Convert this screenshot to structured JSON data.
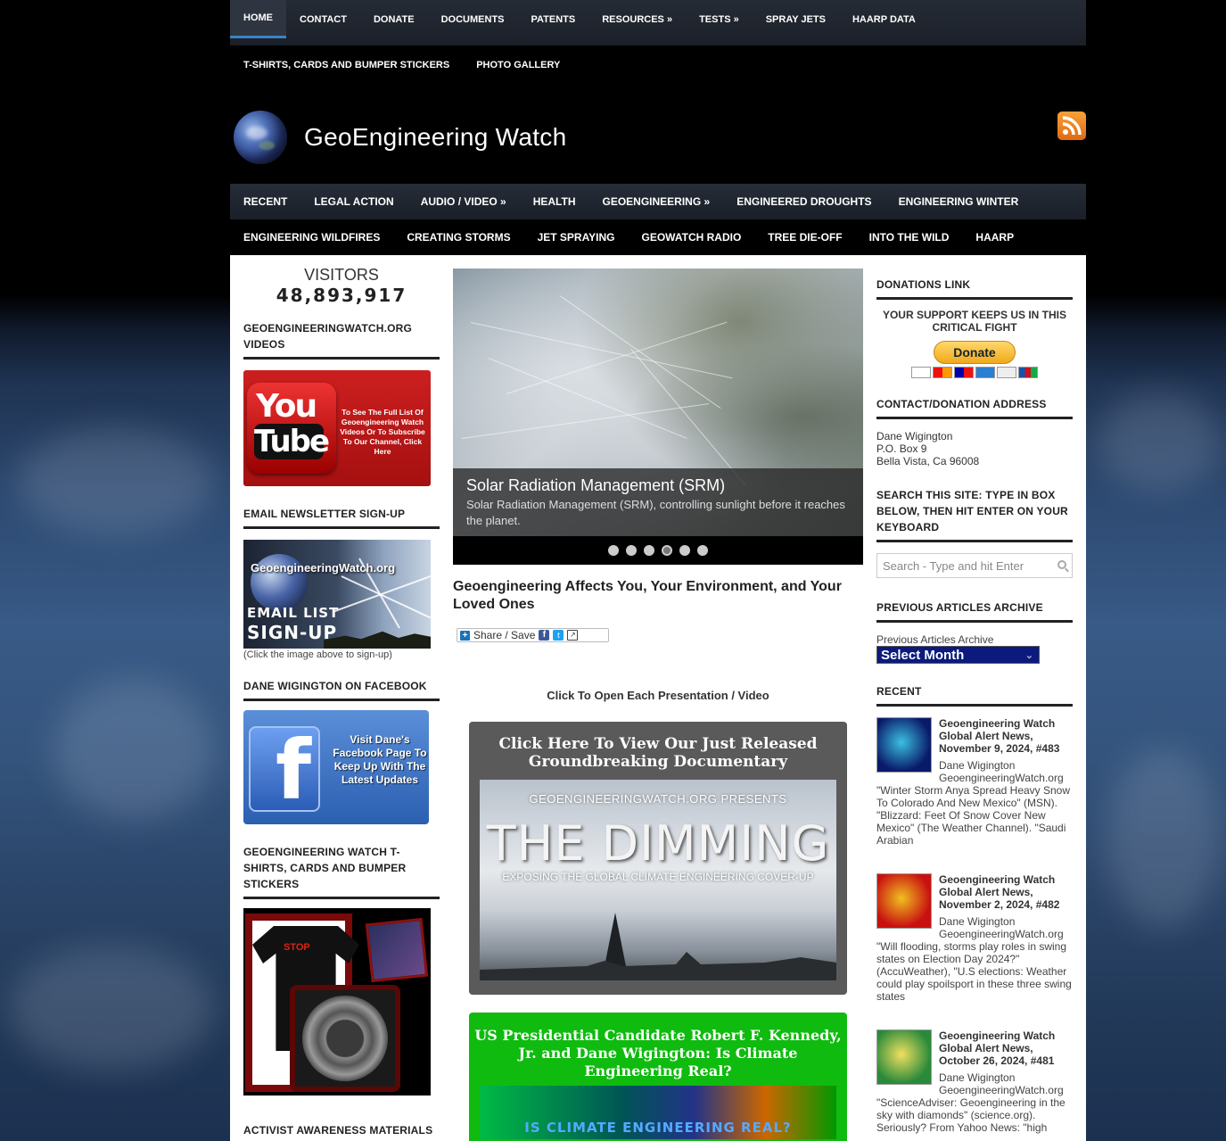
{
  "topnav": {
    "row1": [
      {
        "label": "HOME",
        "active": true
      },
      {
        "label": "CONTACT"
      },
      {
        "label": "DONATE"
      },
      {
        "label": "DOCUMENTS"
      },
      {
        "label": "PATENTS"
      },
      {
        "label": "RESOURCES »"
      },
      {
        "label": "TESTS »"
      },
      {
        "label": "SPRAY JETS"
      },
      {
        "label": "HAARP DATA"
      }
    ],
    "row2": [
      {
        "label": "T-SHIRTS, CARDS AND BUMPER STICKERS"
      },
      {
        "label": "PHOTO GALLERY"
      }
    ]
  },
  "header": {
    "title": "GeoEngineering Watch",
    "rss_icon": "rss-icon"
  },
  "mainnav": {
    "row1": [
      "RECENT",
      "LEGAL ACTION",
      "AUDIO / VIDEO  »",
      "HEALTH",
      "GEOENGINEERING  »",
      "ENGINEERED DROUGHTS",
      "ENGINEERING WINTER"
    ],
    "row2": [
      "ENGINEERING WILDFIRES",
      "CREATING STORMS",
      "JET SPRAYING",
      "GEOWATCH RADIO",
      "TREE DIE-OFF",
      "INTO THE WILD",
      "HAARP"
    ]
  },
  "left": {
    "visitors_label": "VISITORS",
    "visitors_count": "48,893,917",
    "videos_title": "GEOENGINEERINGWATCH.ORG VIDEOS",
    "youtube": {
      "you": "You",
      "tube": "Tube",
      "text": "To See The Full List Of Geoengineering Watch Videos Or To Subscribe To Our Channel, Click Here"
    },
    "newsletter_title": "EMAIL NEWSLETTER SIGN-UP",
    "newsletter": {
      "brand": "GeoengineeringWatch.org",
      "line1": "EMAIL LIST",
      "line2": "SIGN-UP",
      "caption": "(Click the image above to sign-up)"
    },
    "facebook_title": "DANE WIGINGTON ON FACEBOOK",
    "facebook_text": "Visit Dane's Facebook Page To Keep Up With The Latest Updates",
    "shirts_title": "GEOENGINEERING WATCH T-SHIRTS, CARDS AND BUMPER STICKERS",
    "shirts_stop": "STOP",
    "activist_title": "ACTIVIST AWARENESS MATERIALS"
  },
  "slider": {
    "title": "Solar Radiation Management (SRM)",
    "desc": "Solar Radiation Management (SRM), controlling sunlight before it reaches the planet.",
    "dots": 6,
    "active_dot": 4
  },
  "post": {
    "title": "Geoengineering Affects You, Your Environment, and Your Loved Ones",
    "share_label": "Share / Save",
    "click_open": "Click To Open Each Presentation / Video"
  },
  "promo1": {
    "head": "Click Here To View Our Just Released Groundbreaking Documentary",
    "presents": "GEOENGINEERINGWATCH.ORG PRESENTS",
    "big": "THE DIMMING",
    "sub": "EXPOSING THE GLOBAL CLIMATE ENGINEERING COVER-UP"
  },
  "promo2": {
    "head": "US Presidential Candidate Robert F. Kennedy, Jr. and Dane Wigington: Is Climate Engineering Real?",
    "strip": "IS CLIMATE ENGINEERING REAL?"
  },
  "right": {
    "donations_title": "DONATIONS LINK",
    "support": "YOUR SUPPORT KEEPS US IN THIS CRITICAL FIGHT",
    "donate_label": "Donate",
    "address_title": "CONTACT/DONATION ADDRESS",
    "address": [
      "Dane Wigington",
      "P.O. Box 9",
      "Bella Vista, Ca 96008"
    ],
    "search_title": "SEARCH THIS SITE: TYPE IN BOX BELOW, THEN HIT ENTER ON YOUR KEYBOARD",
    "search_placeholder": "Search - Type and hit Enter",
    "archive_title": "PREVIOUS ARTICLES ARCHIVE",
    "archive_label": "Previous Articles Archive",
    "archive_select": "Select Month",
    "recent_title": "RECENT",
    "recent": [
      {
        "title": "Geoengineering Watch Global Alert News, November 9, 2024, #483",
        "by": "Dane Wigington GeoengineeringWatch.org",
        "body": "\"Winter Storm Anya Spread Heavy Snow To Colorado And New Mexico\" (MSN). \"Blizzard: Feet Of Snow Cover New Mexico\" (The Weather Channel). \"Saudi Arabian",
        "thumb_colors": [
          "#0a1a6a",
          "#3ac0e0"
        ]
      },
      {
        "title": "Geoengineering Watch Global Alert News, November 2, 2024, #482",
        "by": "Dane Wigington GeoengineeringWatch.org",
        "body": "\"Will flooding, storms play roles in swing states on Election Day 2024?\" (AccuWeather), \"U.S elections: Weather could play spoilsport in these three swing states",
        "thumb_colors": [
          "#c81010",
          "#f0c020"
        ]
      },
      {
        "title": "Geoengineering Watch Global Alert News, October 26, 2024, #481",
        "by": "Dane Wigington GeoengineeringWatch.org",
        "body": "\"ScienceAdviser: Geoengineering in the sky with diamonds\" (science.org). Seriously? From Yahoo News: \"high",
        "thumb_colors": [
          "#2a8a3a",
          "#f0e060"
        ]
      }
    ]
  }
}
